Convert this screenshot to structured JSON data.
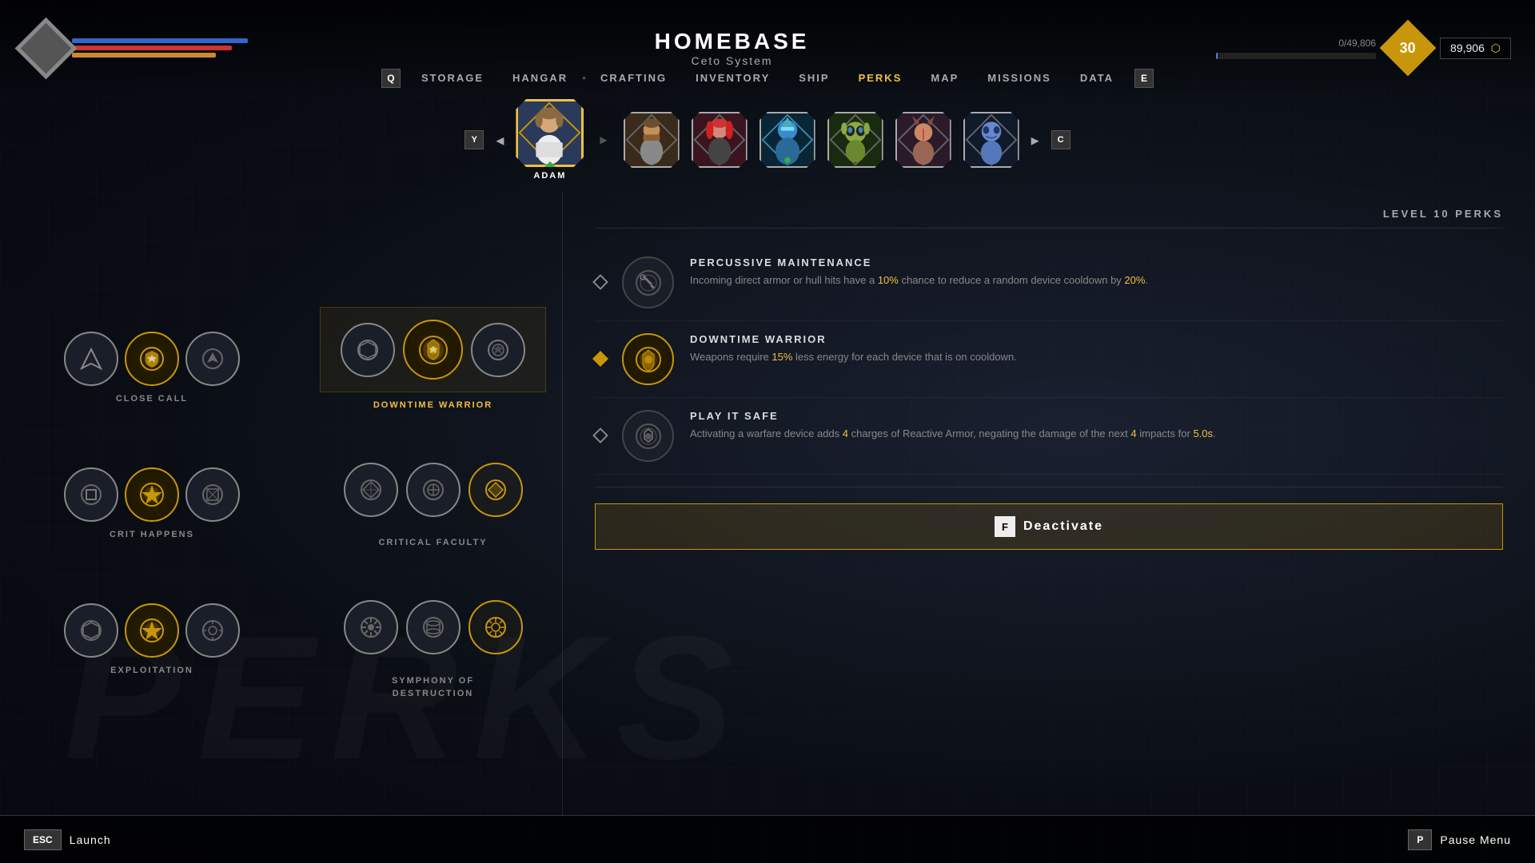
{
  "header": {
    "title": "HOMEBASE",
    "subtitle": "Ceto System",
    "resource_current": "0",
    "resource_max": "49,806",
    "resource_display": "0/49,806",
    "level": "30",
    "currency": "89,906"
  },
  "nav": {
    "key_left": "Q",
    "key_right": "E",
    "items": [
      {
        "label": "STORAGE",
        "active": false
      },
      {
        "label": "HANGAR",
        "active": false
      },
      {
        "label": "CRAFTING",
        "active": false
      },
      {
        "label": "INVENTORY",
        "active": false
      },
      {
        "label": "SHIP",
        "active": false
      },
      {
        "label": "PERKS",
        "active": true
      },
      {
        "label": "MAP",
        "active": false
      },
      {
        "label": "MISSIONS",
        "active": false
      },
      {
        "label": "DATA",
        "active": false
      }
    ]
  },
  "characters": [
    {
      "name": "ADAM",
      "active": true,
      "color": "#3a4a6a"
    },
    {
      "name": "",
      "active": false,
      "color": "#5a3a2a"
    },
    {
      "name": "",
      "active": false,
      "color": "#6a2a3a"
    },
    {
      "name": "",
      "active": false,
      "color": "#1a4a5a"
    },
    {
      "name": "",
      "active": false,
      "color": "#3a5a2a"
    },
    {
      "name": "",
      "active": false,
      "color": "#5a3a4a"
    },
    {
      "name": "",
      "active": false,
      "color": "#2a3a5a"
    }
  ],
  "left_perks": [
    {
      "label": "CLOSE CALL",
      "icons": [
        "arrow",
        "shield",
        "up-arrow"
      ]
    },
    {
      "label": "CRIT HAPPENS",
      "icons": [
        "square",
        "star",
        "grid"
      ]
    },
    {
      "label": "EXPLOITATION",
      "icons": [
        "hex",
        "star",
        "cog"
      ]
    }
  ],
  "center_perks": [
    {
      "label": "DOWNTIME WARRIOR",
      "selected": true,
      "icons": [
        "hex-outline",
        "fire-shield",
        "circle-arrow"
      ]
    },
    {
      "label": "CRITICAL FACULTY",
      "selected": false,
      "icons": [
        "diamond-x",
        "cross-circle",
        "diamond-fill"
      ]
    },
    {
      "label": "SYMPHONY OF DESTRUCTION",
      "selected": false,
      "icons": [
        "burst",
        "cylinder",
        "cog-sun"
      ]
    }
  ],
  "right_panel": {
    "title": "LEVEL 10 PERKS",
    "perks": [
      {
        "name": "PERCUSSIVE MAINTENANCE",
        "selected": false,
        "description_parts": [
          {
            "text": "Incoming direct armor or hull hits have a "
          },
          {
            "text": "10%",
            "highlight": "gold"
          },
          {
            "text": " chance to reduce a random device cooldown by "
          },
          {
            "text": "20%",
            "highlight": "gold"
          },
          {
            "text": "."
          }
        ]
      },
      {
        "name": "DOWNTIME WARRIOR",
        "selected": true,
        "description_parts": [
          {
            "text": "Weapons require "
          },
          {
            "text": "15%",
            "highlight": "gold"
          },
          {
            "text": " less energy for each device that is on cooldown."
          }
        ]
      },
      {
        "name": "PLAY IT SAFE",
        "selected": false,
        "description_parts": [
          {
            "text": "Activating a warfare device adds "
          },
          {
            "text": "4",
            "highlight": "gold"
          },
          {
            "text": " charges of Reactive Armor, negating the damage of the next "
          },
          {
            "text": "4",
            "highlight": "gold"
          },
          {
            "text": " impacts for "
          },
          {
            "text": "5.0s",
            "highlight": "gold"
          },
          {
            "text": "."
          }
        ]
      }
    ]
  },
  "deactivate_btn": {
    "key": "F",
    "label": "Deactivate"
  },
  "bottom": {
    "left_key": "ESC",
    "left_label": "Launch",
    "right_key": "P",
    "right_label": "Pause Menu"
  },
  "bg_text": "PERKS"
}
